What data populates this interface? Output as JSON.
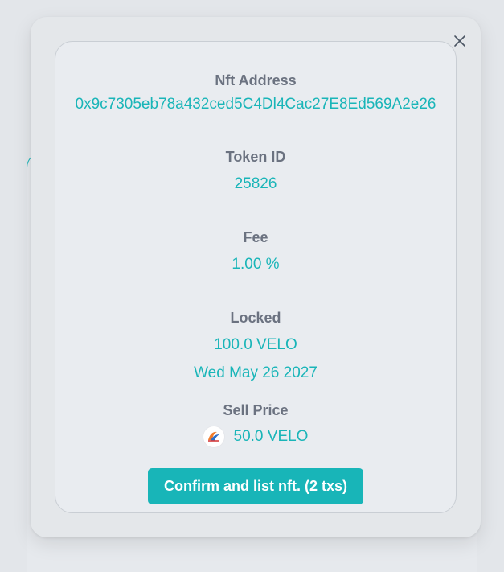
{
  "modal": {
    "nft_address": {
      "label": "Nft Address",
      "value": "0x9c7305eb78a432ced5C4Dl4Cac27E8Ed569A2e26"
    },
    "token_id": {
      "label": "Token ID",
      "value": "25826"
    },
    "fee": {
      "label": "Fee",
      "value": "1.00 %"
    },
    "locked": {
      "label": "Locked",
      "amount": "100.0 VELO",
      "date": "Wed May 26 2027"
    },
    "sell_price": {
      "label": "Sell Price",
      "value": "50.0 VELO",
      "token_icon": "velo-token-icon"
    },
    "confirm_button_label": "Confirm and list nft. (2 txs)",
    "close_icon": "close-icon"
  },
  "colors": {
    "accent": "#19b5b8",
    "label": "#6b7280",
    "background": "#e3e6ea"
  }
}
